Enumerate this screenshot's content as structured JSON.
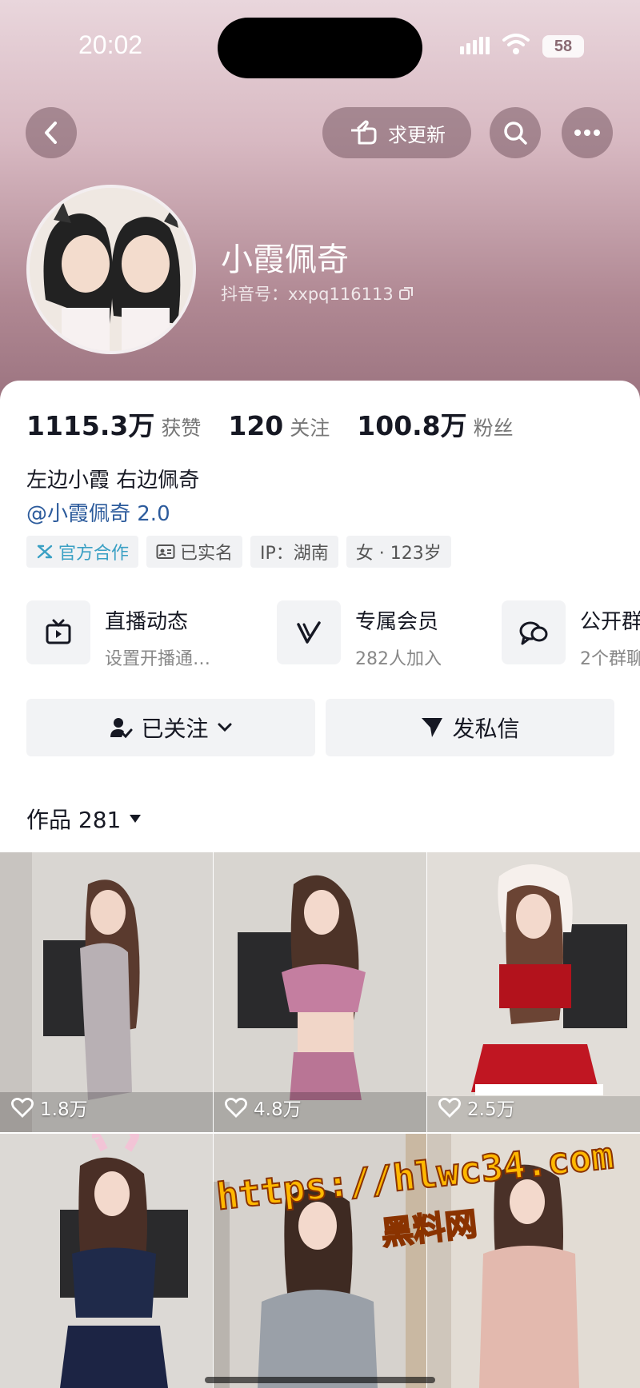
{
  "status_bar": {
    "time": "20:02",
    "battery": "58"
  },
  "nav": {
    "request_update_label": "求更新"
  },
  "profile": {
    "nickname": "小霞佩奇",
    "douyin_id": "抖音号：xxpq116113"
  },
  "stats": [
    {
      "value": "1115.3万",
      "label": "获赞"
    },
    {
      "value": "120",
      "label": "关注"
    },
    {
      "value": "100.8万",
      "label": "粉丝"
    }
  ],
  "bio": "左边小霞 右边佩奇",
  "mention": "@小霞佩奇 2.0",
  "tags": [
    {
      "label": "官方合作",
      "icon": "official-cooperation-icon"
    },
    {
      "label": "已实名",
      "icon": "id-card-icon"
    },
    {
      "label": "IP：湖南"
    },
    {
      "label": "女 · 123岁"
    }
  ],
  "features": [
    {
      "title": "直播动态",
      "subtitle": "设置开播通…",
      "icon": "tv-icon"
    },
    {
      "title": "专属会员",
      "subtitle": "282人加入",
      "icon": "v-badge-icon"
    },
    {
      "title": "公开群",
      "subtitle": "2个群聊",
      "icon": "chat-group-icon"
    }
  ],
  "actions": {
    "follow_label": "已关注",
    "message_label": "发私信"
  },
  "works": {
    "label": "作品 281"
  },
  "videos": [
    {
      "likes": "1.8万"
    },
    {
      "likes": "4.8万"
    },
    {
      "likes": "2.5万"
    }
  ],
  "watermark": {
    "url": "https://hlwc34.com",
    "label": "黑料网"
  },
  "colors": {
    "accent_link": "#2c5b9c",
    "official_tag": "#3aa0c4",
    "watermark": "#ffb800"
  }
}
